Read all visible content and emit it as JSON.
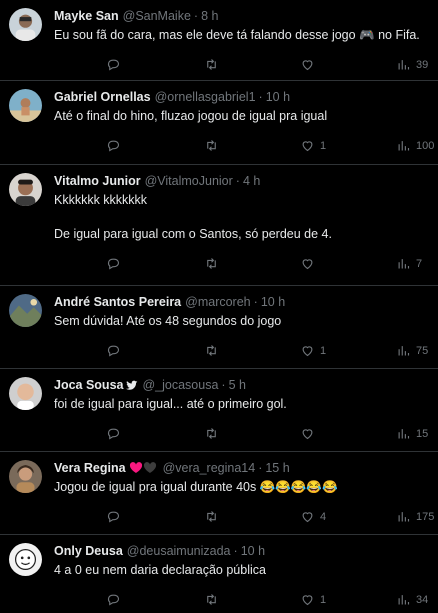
{
  "tweets": [
    {
      "name": "Mayke San",
      "handle": "@SanMaike",
      "time": "8 h",
      "text": "Eu sou fã do cara, mas ele deve tá falando desse jogo 🎮 no Fifa.",
      "replies": "",
      "retweets": "",
      "likes": "",
      "views": "39"
    },
    {
      "name": "Gabriel Ornellas",
      "handle": "@ornellasgabriel1",
      "time": "10 h",
      "text": "Até o final do hino, fluzao jogou de igual pra igual",
      "replies": "",
      "retweets": "",
      "likes": "1",
      "views": "100"
    },
    {
      "name": "Vitalmo Junior",
      "handle": "@VitalmoJunior",
      "time": "4 h",
      "text": "Kkkkkkk kkkkkkk\n\nDe igual para igual com o Santos, só perdeu de 4.",
      "replies": "",
      "retweets": "",
      "likes": "",
      "views": "7"
    },
    {
      "name": "André Santos Pereira",
      "handle": "@marcoreh",
      "time": "10 h",
      "text": "Sem dúvida! Até os 48 segundos do jogo",
      "replies": "",
      "retweets": "",
      "likes": "1",
      "views": "75"
    },
    {
      "name": "Joca Sousa",
      "handle": "@_jocasousa",
      "time": "5 h",
      "text": "foi de igual para igual... até o primeiro gol.",
      "replies": "",
      "retweets": "",
      "likes": "",
      "views": "15"
    },
    {
      "name": "Vera Regina",
      "handle": "@vera_regina14",
      "time": "15 h",
      "text": "Jogou de igual pra igual durante 40s 😂😂😂😂😂",
      "replies": "",
      "retweets": "",
      "likes": "4",
      "views": "175"
    },
    {
      "name": "Only Deusa",
      "handle": "@deusaimunizada",
      "time": "10 h",
      "text": "4 a 0 eu nem daria declaração pública",
      "replies": "",
      "retweets": "",
      "likes": "1",
      "views": "34"
    }
  ],
  "icons": {
    "reply": "reply-icon",
    "retweet": "retweet-icon",
    "like": "heart-icon",
    "views": "views-icon",
    "bird": "bird-icon",
    "hearts": "hearts-emoji"
  },
  "colors": {
    "background": "#000000",
    "text": "#e7e9ea",
    "muted": "#71767b",
    "divider": "#2f3336",
    "heart_red": "#f91880",
    "twitter_blue": "#1d9bf0"
  }
}
